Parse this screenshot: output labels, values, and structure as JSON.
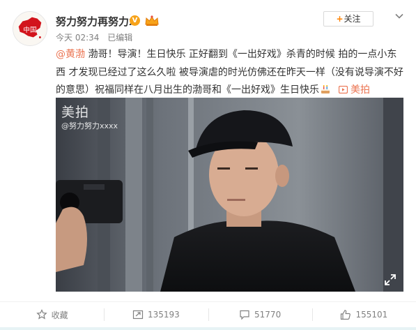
{
  "user": {
    "name": "努力努力再努力x",
    "avatar_text": "中国",
    "verified_badge": "V",
    "crown_icon": "crown-icon"
  },
  "meta": {
    "time": "今天 02:34",
    "edited": "已编辑"
  },
  "follow": {
    "plus": "+",
    "label": "关注"
  },
  "post": {
    "mention": "@黄渤",
    "text": " 渤哥！导演！生日快乐 正好翻到《一出好戏》杀青的时候 拍的一点小东西 才发现已经过了这么久啦 被导演虐的时光仿佛还在昨天一样（没有说导演不好的意思）祝福同样在八月出生的渤哥和《一出好戏》生日快乐",
    "emoji": "cake-icon",
    "source_label": "美拍"
  },
  "video": {
    "watermark_title": "美拍",
    "watermark_user": "@努力努力xxxx"
  },
  "actions": {
    "favorite_label": "收藏",
    "repost_count": "135193",
    "comment_count": "51770",
    "like_count": "155101"
  },
  "colors": {
    "accent": "#eb7350",
    "follow_plus": "#ff8200",
    "badge": "#f7a31a"
  }
}
